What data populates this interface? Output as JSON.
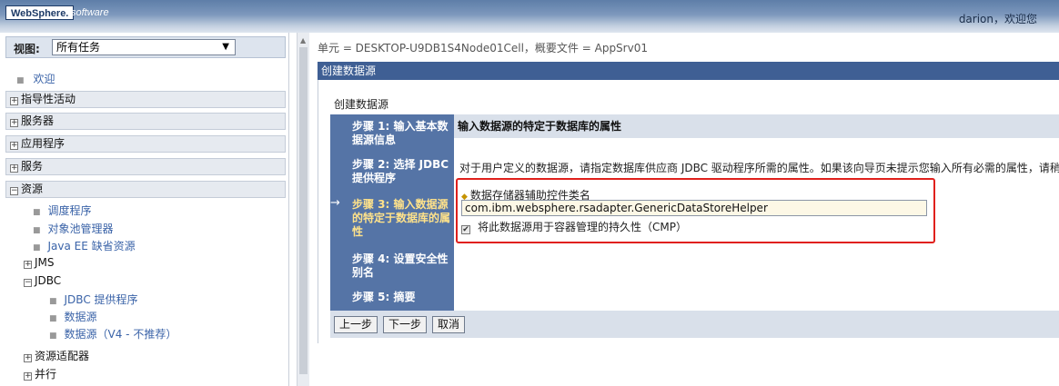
{
  "header": {
    "logo_brand": "WebSphere.",
    "logo_suffix": "software",
    "user_greeting": "darion，欢迎您"
  },
  "nav": {
    "view_label": "视图:",
    "view_selected": "所有任务",
    "welcome": "欢迎",
    "groups": [
      "指导性活动",
      "服务器",
      "应用程序",
      "服务",
      "资源"
    ],
    "resource_items": [
      "调度程序",
      "对象池管理器",
      "Java EE 缺省资源"
    ],
    "jms": "JMS",
    "jdbc": "JDBC",
    "jdbc_items": [
      "JDBC 提供程序",
      "数据源",
      "数据源（V4 - 不推荐）"
    ],
    "resource_adapters": "资源适配器",
    "concurrency": "并行"
  },
  "main": {
    "scope": "单元 = DESKTOP-U9DB1S4Node01Cell，概要文件 = AppSrv01",
    "panel_title": "创建数据源",
    "wizard_heading": "创建数据源",
    "steps": [
      "步骤 1: 输入基本数据源信息",
      "步骤 2: 选择 JDBC 提供程序",
      "步骤 3: 输入数据源的特定于数据库的属性",
      "步骤 4: 设置安全性别名",
      "步骤 5: 摘要"
    ],
    "content_header": "输入数据源的特定于数据库的属性",
    "description": "对于用户定义的数据源，请指定数据库供应商 JDBC 驱动程序所需的属性。如果该向导页未提示您输入所有必需的属性，请稍",
    "helper_label": "数据存储器辅助控件类名",
    "helper_value": "com.ibm.websphere.rsadapter.GenericDataStoreHelper",
    "cmp_label": "将此数据源用于容器管理的持久性（CMP）",
    "buttons": {
      "previous": "上一步",
      "next": "下一步",
      "cancel": "取消"
    }
  }
}
